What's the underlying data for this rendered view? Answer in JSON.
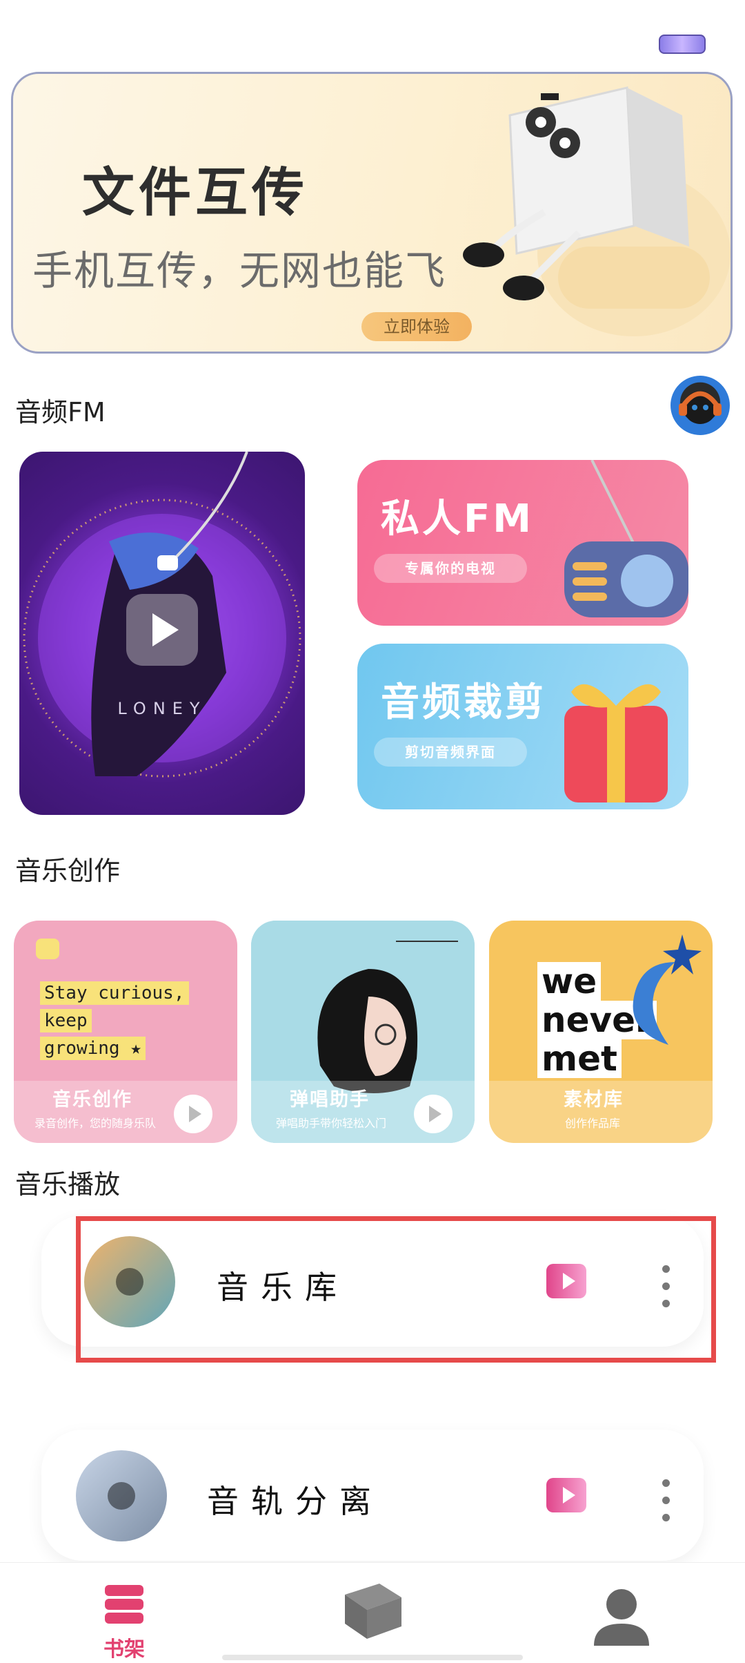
{
  "banner": {
    "title": "文件互传",
    "subtitle": "手机互传，无网也能飞",
    "cta": "立即体验"
  },
  "sections": {
    "fm": "音频FM",
    "creation": "音乐创作",
    "playback": "音乐播放"
  },
  "fm_cards": {
    "big_caption": "L O N E Y",
    "private_fm": {
      "title": "私人FM",
      "subtitle": "专属你的电视"
    },
    "audio_cut": {
      "title": "音频裁剪",
      "subtitle": "剪切音频界面"
    }
  },
  "creation_cards": [
    {
      "label": "音乐创作",
      "sub": "录音创作，您的随身乐队",
      "lines": [
        "Stay curious,",
        "keep",
        "growing ★"
      ]
    },
    {
      "label": "弹唱助手",
      "sub": "弹唱助手带你轻松入门"
    },
    {
      "label": "素材库",
      "sub": "创作作品库",
      "art_text": [
        "we",
        "never",
        "met"
      ]
    }
  ],
  "playback_rows": [
    {
      "label": "音乐库"
    },
    {
      "label": "音轨分离"
    }
  ],
  "bottom_nav": {
    "bookshelf": "书架"
  },
  "colors": {
    "accent": "#e24170",
    "highlight": "#e64a4a"
  }
}
